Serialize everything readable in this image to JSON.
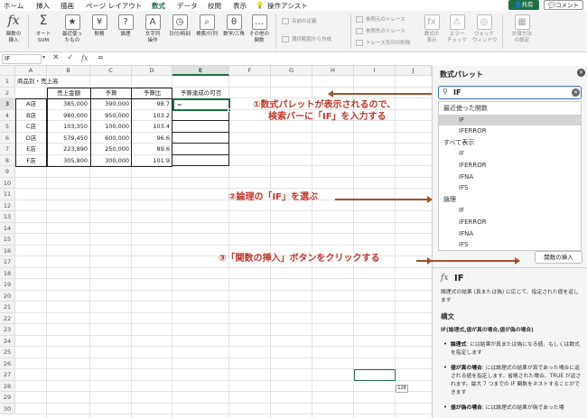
{
  "menu": {
    "tabs": [
      "ホーム",
      "挿入",
      "描画",
      "ページ レイアウト",
      "数式",
      "データ",
      "校閲",
      "表示",
      "操作アシスト"
    ],
    "active_tab": "数式",
    "share_label": "共有",
    "comment_label": "コメント"
  },
  "ribbon": {
    "insert_function": "関数の\n挿入",
    "autosum": "オート\nSUM",
    "recent": "最近使っ\nたもの",
    "financial": "財務",
    "logical": "論理",
    "text": "文字列\n操作",
    "datetime": "日付/時刻",
    "lookup": "検索/行列",
    "math": "数学/三角",
    "more": "その他の\n関数",
    "name_def": "名前の定義",
    "create_from_sel": "選択範囲から作成",
    "trace_precedents": "参照元のトレース",
    "trace_dependents": "参照先のトレース",
    "remove_arrows": "トレース矢印の削除",
    "show_formulas": "数式の\n表示",
    "error_check": "エラー\nチェック",
    "watch_window": "ウォッチ\nウィンドウ",
    "calc_options": "計算方法\nの設定"
  },
  "formula_bar": {
    "name_box": "IF",
    "input": "="
  },
  "sheet": {
    "columns": [
      "A",
      "B",
      "C",
      "D",
      "E",
      "F",
      "G",
      "H",
      "I",
      "J"
    ],
    "rows": [
      "1",
      "2",
      "3",
      "4",
      "5",
      "6",
      "7",
      "8",
      "9",
      "10",
      "11",
      "12",
      "13",
      "14",
      "15",
      "16",
      "17",
      "18",
      "19",
      "20",
      "21",
      "22",
      "23",
      "24",
      "25",
      "26",
      "27",
      "28",
      "29",
      "30"
    ],
    "title": "商品別・売上高",
    "headers": [
      "売上金額",
      "予算",
      "予算比",
      "予算達成の可否"
    ],
    "data_rows": [
      {
        "store": "A店",
        "sales": "385,000",
        "budget": "390,000",
        "ratio": "98.7"
      },
      {
        "store": "B店",
        "sales": "980,000",
        "budget": "950,000",
        "ratio": "103.2"
      },
      {
        "store": "C店",
        "sales": "103,350",
        "budget": "100,000",
        "ratio": "103.4"
      },
      {
        "store": "D店",
        "sales": "579,450",
        "budget": "600,000",
        "ratio": "96.6"
      },
      {
        "store": "E店",
        "sales": "223,890",
        "budget": "250,000",
        "ratio": "89.6"
      },
      {
        "store": "F店",
        "sales": "305,800",
        "budget": "300,000",
        "ratio": "101.9"
      }
    ],
    "active_cell_value": "=",
    "tooltip_box": "128"
  },
  "annotations": {
    "step1_line1": "①数式パレットが表示されるので、",
    "step1_line2": "検索バーに「IF」を入力する",
    "step2": "②論理の「IF」を選ぶ",
    "step3": "③「関数の挿入」ボタンをクリックする"
  },
  "panel": {
    "title": "数式パレット",
    "search_value": "IF",
    "list": [
      {
        "kind": "head",
        "label": "最近使った関数"
      },
      {
        "kind": "item",
        "label": "IF",
        "highlight": true
      },
      {
        "kind": "item",
        "label": "IFERROR"
      },
      {
        "kind": "head",
        "label": "すべて表示"
      },
      {
        "kind": "item",
        "label": "IF"
      },
      {
        "kind": "item",
        "label": "IFERROR"
      },
      {
        "kind": "item",
        "label": "IFNA"
      },
      {
        "kind": "item",
        "label": "IFS"
      },
      {
        "kind": "head",
        "label": "論理"
      },
      {
        "kind": "item",
        "label": "IF"
      },
      {
        "kind": "item",
        "label": "IFERROR"
      },
      {
        "kind": "item",
        "label": "IFNA"
      },
      {
        "kind": "item",
        "label": "IFS"
      }
    ],
    "insert_button": "関数の挿入",
    "fx_symbol": "fx",
    "func_name": "IF",
    "description": "論理式の結果 (真または偽) に応じて、指定された値を返します",
    "syntax_heading": "構文",
    "syntax": "IF(論理式,値が真の場合,値が偽の場合)",
    "arg1_name": "論理式",
    "arg1_desc": ": には結果が真または偽になる値、もしくは数式を指定します",
    "arg2_name": "値が真の場合",
    "arg2_desc": ": には論理式の結果が真であった場合に返される値を指定します。省略された場合、TRUE が返されます。最大 7 つまでの IF 関数をネストすることができます",
    "arg3_name": "値が偽の場合",
    "arg3_desc": ": には論理式の結果が偽であった場"
  }
}
